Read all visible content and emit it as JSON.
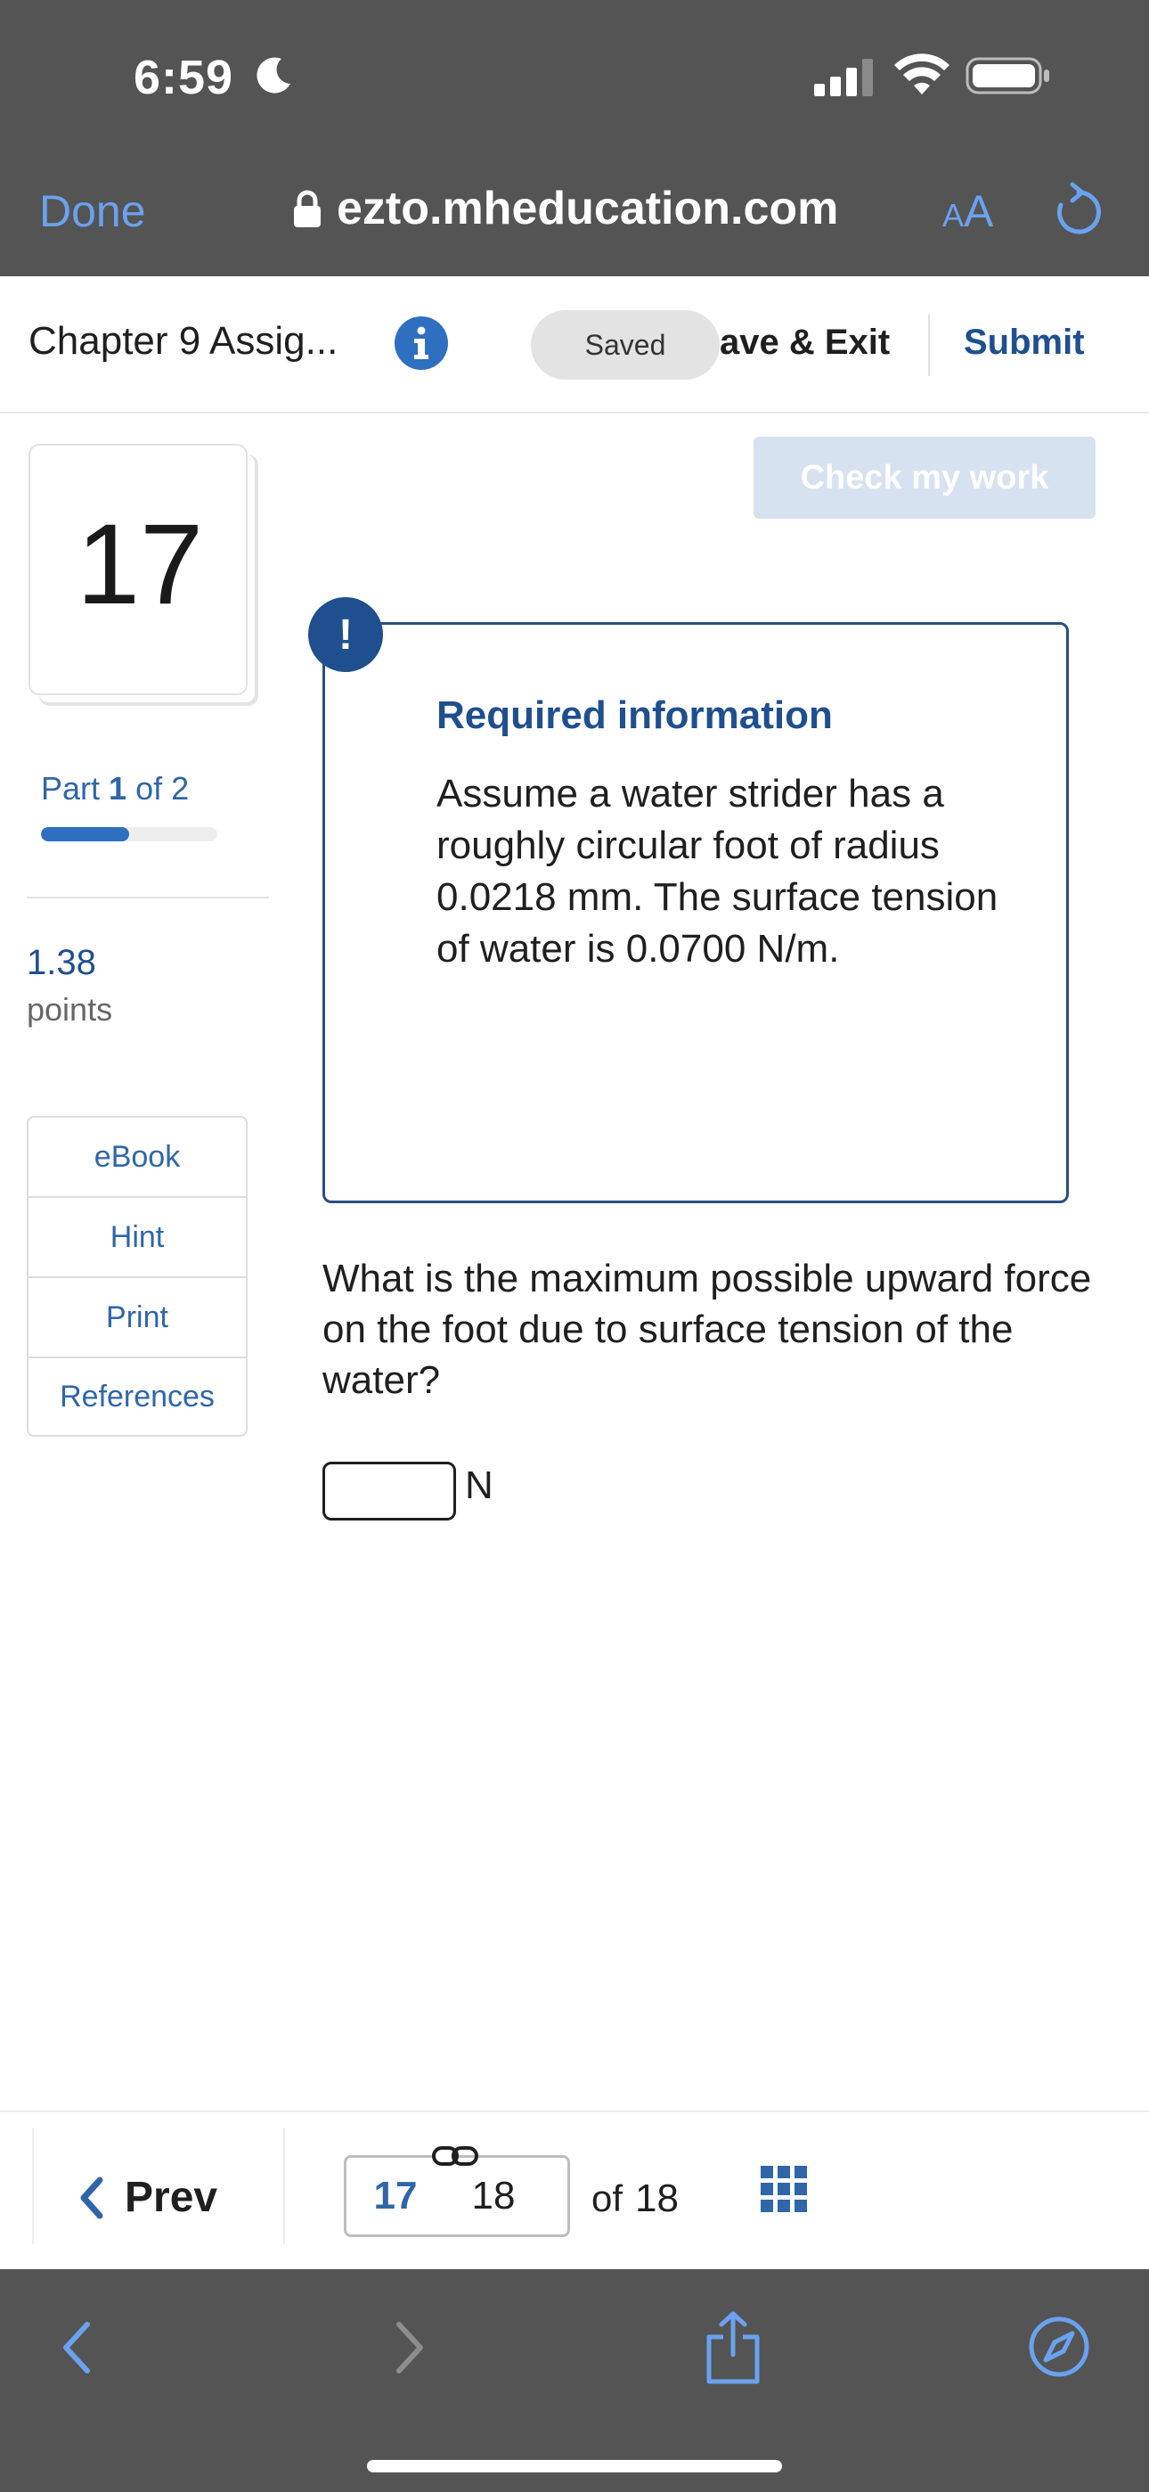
{
  "status_bar": {
    "time": "6:59"
  },
  "browser": {
    "done_label": "Done",
    "url": "ezto.mheducation.com",
    "text_size_label_small": "A",
    "text_size_label_large": "A"
  },
  "header": {
    "chapter_title": "Chapter 9 Assig...",
    "saved_label": "Saved",
    "save_exit_label": "ave & Exit",
    "submit_label": "Submit"
  },
  "sidebar": {
    "question_number": "17",
    "part_word": "Part",
    "part_current": "1",
    "part_of": "of 2",
    "part_progress": 0.5,
    "points_value": "1.38",
    "points_label": "points",
    "tools": [
      {
        "label": "eBook"
      },
      {
        "label": "Hint"
      },
      {
        "label": "Print"
      },
      {
        "label": "References"
      }
    ]
  },
  "main": {
    "check_my_work_label": "Check my work",
    "alert_symbol": "!",
    "required_title": "Required information",
    "required_text": "Assume a water strider has a roughly circular foot of radius 0.0218 mm. The surface tension of water is 0.0700 N/m.",
    "question_text": "What is the maximum possible upward force on the foot due to surface tension of the water?",
    "answer_value": "",
    "answer_unit": "N"
  },
  "pager": {
    "prev_label": "Prev",
    "current_page": "17",
    "next_page": "18",
    "of_label": "of",
    "total_pages": "18"
  },
  "colors": {
    "accent": "#1f4f8f",
    "link": "#2f66a8",
    "browser_chrome": "#545454",
    "browser_link": "#6aa2ef",
    "check_button_disabled": "#d6e2f0"
  },
  "icons": {
    "moon": "moon-icon",
    "signal": "cellular-signal-icon",
    "wifi": "wifi-icon",
    "battery": "battery-icon",
    "lock": "lock-icon",
    "reload": "reload-icon",
    "info": "info-icon",
    "chevron_left": "chevron-left-icon",
    "link": "link-icon",
    "grid": "grid-icon",
    "back": "back-arrow-icon",
    "forward": "forward-arrow-icon",
    "share": "share-icon",
    "compass": "compass-icon"
  }
}
